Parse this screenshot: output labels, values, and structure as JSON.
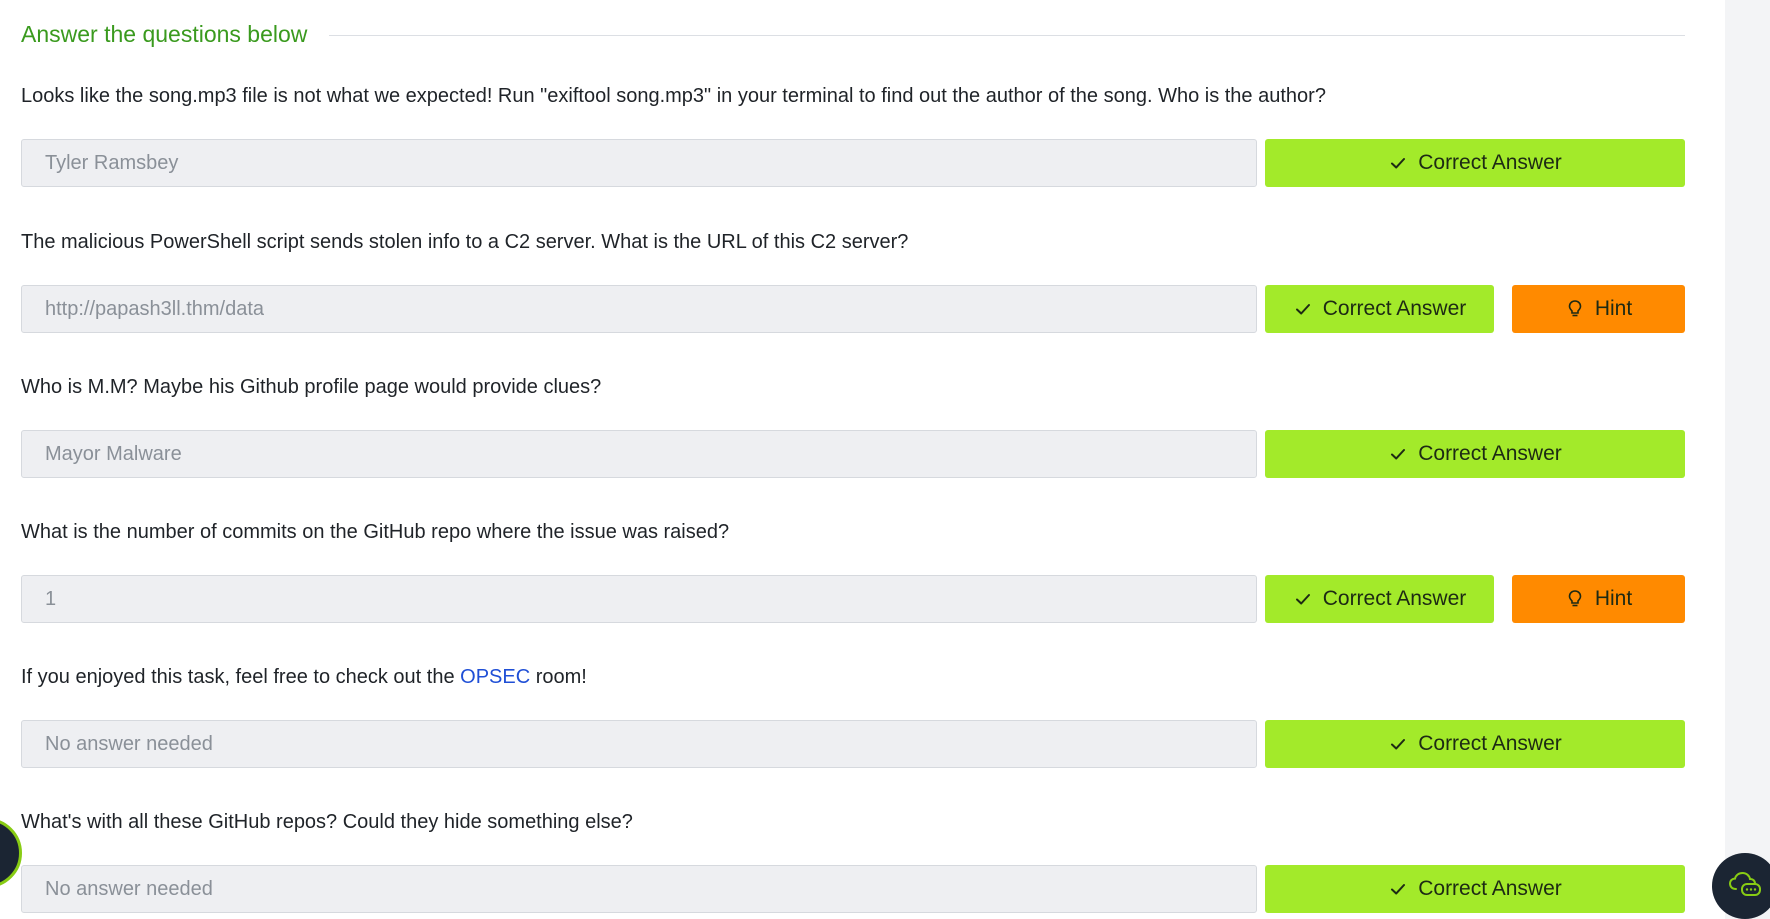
{
  "header": {
    "title": "Answer the questions below"
  },
  "questions": [
    {
      "text": "Looks like the song.mp3 file is not what we expected! Run \"exiftool song.mp3\" in your terminal to find out the author of the song. Who is the author?",
      "answer": "Tyler Ramsbey",
      "correct_label": "Correct Answer"
    },
    {
      "text": "The malicious PowerShell script sends stolen info to a C2 server. What is the URL of this C2 server?",
      "answer": "http://papash3ll.thm/data",
      "correct_label": "Correct Answer",
      "hint_label": "Hint"
    },
    {
      "text": "Who is M.M? Maybe his Github profile page would provide clues?",
      "answer": "Mayor Malware",
      "correct_label": "Correct Answer"
    },
    {
      "text": "What is the number of commits on the GitHub repo where the issue was raised?",
      "answer": "1",
      "correct_label": "Correct Answer",
      "hint_label": "Hint"
    },
    {
      "text_before": "If you enjoyed this task, feel free to check out the ",
      "link": "OPSEC",
      "text_after": " room!",
      "answer": "No answer needed",
      "correct_label": "Correct Answer"
    },
    {
      "text": "What's with all these GitHub repos? Could they hide something else?",
      "answer": "No answer needed",
      "correct_label": "Correct Answer"
    }
  ],
  "icons": {
    "correct": "check-icon",
    "hint": "lightbulb-icon",
    "chat": "chat-cloud-icon"
  },
  "colors": {
    "header": "#3a9a1e",
    "correct_button": "#a3ea2a",
    "hint_button": "#ff8a00",
    "link": "#1f4fd6",
    "input_bg": "#eeeff2"
  }
}
